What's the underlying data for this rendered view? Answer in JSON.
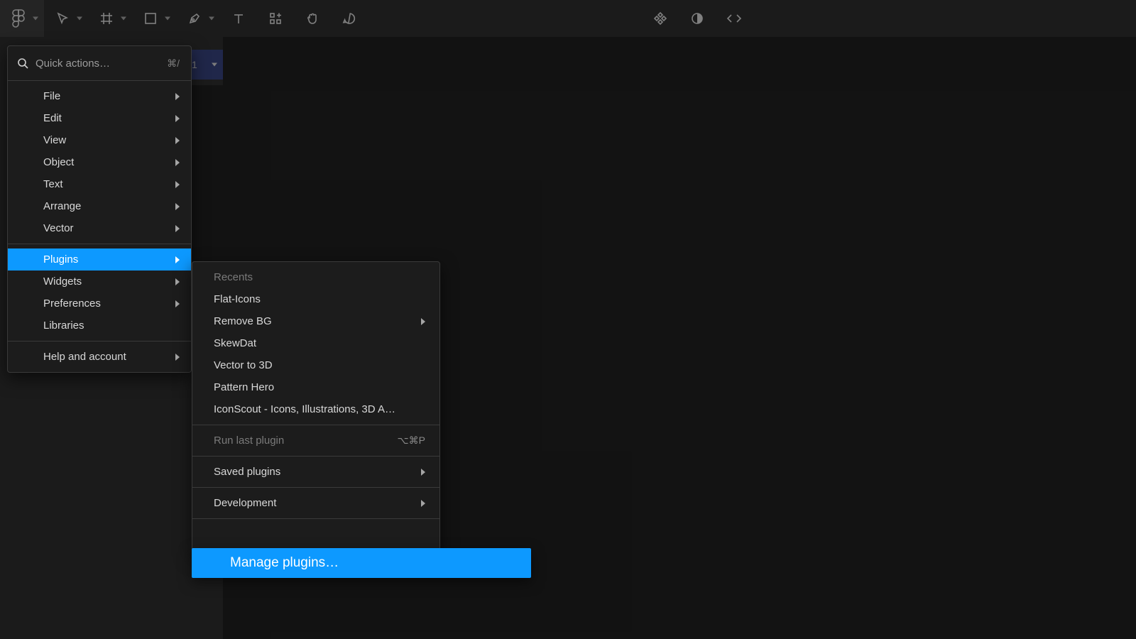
{
  "toolbar": {
    "page_label": "1"
  },
  "quick": {
    "placeholder": "Quick actions…",
    "shortcut": "⌘/"
  },
  "menu": {
    "items": [
      {
        "label": "File",
        "chevron": true
      },
      {
        "label": "Edit",
        "chevron": true
      },
      {
        "label": "View",
        "chevron": true
      },
      {
        "label": "Object",
        "chevron": true
      },
      {
        "label": "Text",
        "chevron": true
      },
      {
        "label": "Arrange",
        "chevron": true
      },
      {
        "label": "Vector",
        "chevron": true
      }
    ],
    "items2": [
      {
        "label": "Plugins",
        "chevron": true,
        "highlight": true
      },
      {
        "label": "Widgets",
        "chevron": true
      },
      {
        "label": "Preferences",
        "chevron": true
      },
      {
        "label": "Libraries",
        "chevron": false
      }
    ],
    "items3": [
      {
        "label": "Help and account",
        "chevron": true
      }
    ]
  },
  "submenu": {
    "recents_header": "Recents",
    "recents": [
      {
        "label": "Flat-Icons"
      },
      {
        "label": "Remove BG",
        "chevron": true
      },
      {
        "label": "SkewDat"
      },
      {
        "label": "Vector to 3D"
      },
      {
        "label": "Pattern Hero"
      },
      {
        "label": "IconScout - Icons, Illustrations, 3D A…"
      }
    ],
    "run_last": {
      "label": "Run last plugin",
      "shortcut": "⌥⌘P"
    },
    "saved": {
      "label": "Saved plugins"
    },
    "development": {
      "label": "Development"
    },
    "manage": {
      "label": "Manage plugins…"
    }
  },
  "colors": {
    "accent": "#0d99ff",
    "bg": "#1e1e1e",
    "panel": "#2c2c2c",
    "menu_bg": "#1c1c1c"
  }
}
